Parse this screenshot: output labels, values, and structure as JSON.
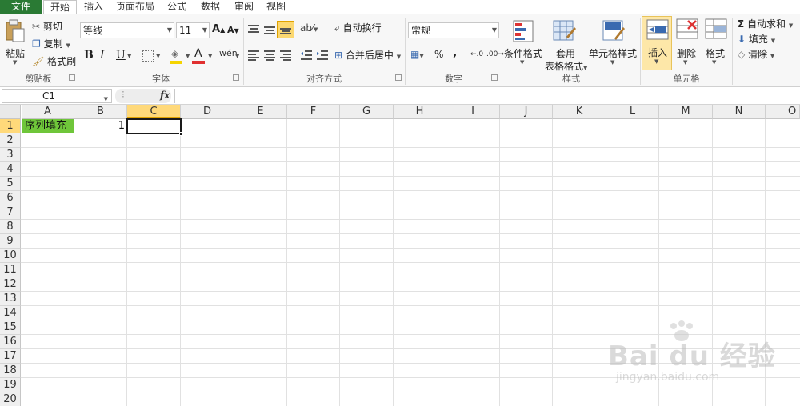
{
  "menu": {
    "tabs": [
      "文件",
      "开始",
      "插入",
      "页面布局",
      "公式",
      "数据",
      "审阅",
      "视图"
    ]
  },
  "ribbon": {
    "clipboard": {
      "paste": "粘贴",
      "cut": "剪切",
      "copy": "复制",
      "format_painter": "格式刷",
      "label": "剪贴板"
    },
    "font": {
      "name": "等线",
      "size": "11",
      "bold": "B",
      "italic": "I",
      "underline": "U",
      "phonetic": "wén",
      "label": "字体",
      "fill_color": "#f5d400",
      "font_color": "#e03030"
    },
    "alignment": {
      "wrap_text": "自动换行",
      "merge_center": "合并后居中",
      "label": "对齐方式"
    },
    "number": {
      "format": "常规",
      "percent": "%",
      "comma": ",",
      "label": "数字"
    },
    "styles": {
      "conditional": "条件格式",
      "table_format_line1": "套用",
      "table_format_line2": "表格格式",
      "cell_styles": "单元格样式",
      "label": "样式"
    },
    "cells": {
      "insert": "插入",
      "delete": "删除",
      "format": "格式",
      "label": "单元格"
    },
    "editing": {
      "autosum": "自动求和",
      "fill": "填充",
      "clear": "清除"
    }
  },
  "formula_bar": {
    "name_box": "C1",
    "fx": "fx",
    "formula": ""
  },
  "sheet": {
    "columns": [
      "A",
      "B",
      "C",
      "D",
      "E",
      "F",
      "G",
      "H",
      "I",
      "J",
      "K",
      "L",
      "M",
      "N",
      "O"
    ],
    "rows": [
      "1",
      "2",
      "3",
      "4",
      "5",
      "6",
      "7",
      "8",
      "9",
      "10",
      "11",
      "12",
      "13",
      "14",
      "15",
      "16",
      "17",
      "18",
      "19",
      "20"
    ],
    "selected_column": "C",
    "selected_row": "1",
    "cells": {
      "A1": "序列填充",
      "B1": "1"
    },
    "a1_fill_color": "#6fc63a"
  },
  "watermark": {
    "brand": "Bai du 经验",
    "url": "jingyan.baidu.com"
  }
}
